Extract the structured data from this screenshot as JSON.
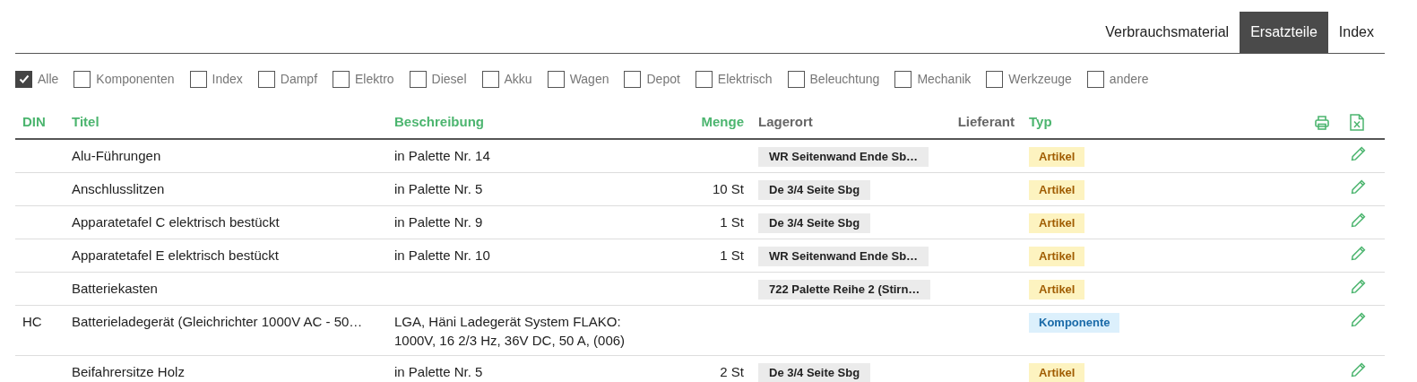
{
  "tabs": [
    {
      "label": "Verbrauchsmaterial",
      "selected": false
    },
    {
      "label": "Ersatzteile",
      "selected": true
    },
    {
      "label": "Index",
      "selected": false
    }
  ],
  "filters": [
    {
      "label": "Alle",
      "checked": true
    },
    {
      "label": "Komponenten",
      "checked": false
    },
    {
      "label": "Index",
      "checked": false
    },
    {
      "label": "Dampf",
      "checked": false
    },
    {
      "label": "Elektro",
      "checked": false
    },
    {
      "label": "Diesel",
      "checked": false
    },
    {
      "label": "Akku",
      "checked": false
    },
    {
      "label": "Wagen",
      "checked": false
    },
    {
      "label": "Depot",
      "checked": false
    },
    {
      "label": "Elektrisch",
      "checked": false
    },
    {
      "label": "Beleuchtung",
      "checked": false
    },
    {
      "label": "Mechanik",
      "checked": false
    },
    {
      "label": "Werkzeuge",
      "checked": false
    },
    {
      "label": "andere",
      "checked": false
    }
  ],
  "table": {
    "columns": [
      {
        "label": "DIN",
        "sortable": true
      },
      {
        "label": "Titel",
        "sortable": true
      },
      {
        "label": "Beschreibung",
        "sortable": true
      },
      {
        "label": "Menge",
        "sortable": true
      },
      {
        "label": "Lagerort",
        "sortable": false
      },
      {
        "label": "Lieferant",
        "sortable": false
      },
      {
        "label": "Typ",
        "sortable": true
      }
    ],
    "rows": [
      {
        "titel": "Alu-Führungen",
        "beschreibung": "in Palette Nr. 14",
        "lagerort": "WR Seitenwand Ende Sb…",
        "typ": {
          "label": "Artikel",
          "kind": "artikel"
        }
      },
      {
        "titel": "Anschlusslitzen",
        "beschreibung": "in Palette Nr. 5",
        "menge": "10 St",
        "lagerort": "De 3/4 Seite Sbg",
        "typ": {
          "label": "Artikel",
          "kind": "artikel"
        }
      },
      {
        "titel": "Apparatetafel C elektrisch bestückt",
        "beschreibung": "in Palette Nr. 9",
        "menge": "1 St",
        "lagerort": "De 3/4 Seite Sbg",
        "typ": {
          "label": "Artikel",
          "kind": "artikel"
        }
      },
      {
        "titel": "Apparatetafel E elektrisch bestückt",
        "beschreibung": "in Palette Nr. 10",
        "menge": "1 St",
        "lagerort": "WR Seitenwand Ende Sb…",
        "typ": {
          "label": "Artikel",
          "kind": "artikel"
        }
      },
      {
        "titel": "Batteriekasten",
        "lagerort": "722 Palette Reihe 2 (Stirn…",
        "typ": {
          "label": "Artikel",
          "kind": "artikel"
        }
      },
      {
        "din": "HC",
        "titel": "Batterieladegerät (Gleichrichter 1000V AC - 50…",
        "beschreibung": "LGA, Häni Ladegerät System FLAKO: 1000V, 16 2/3 Hz, 36V DC, 50 A, (006)",
        "typ": {
          "label": "Komponente",
          "kind": "komponente"
        }
      },
      {
        "titel": "Beifahrersitze Holz",
        "beschreibung": "in Palette Nr. 5",
        "menge": "2 St",
        "lagerort": "De 3/4 Seite Sbg",
        "typ": {
          "label": "Artikel",
          "kind": "artikel"
        }
      }
    ]
  }
}
